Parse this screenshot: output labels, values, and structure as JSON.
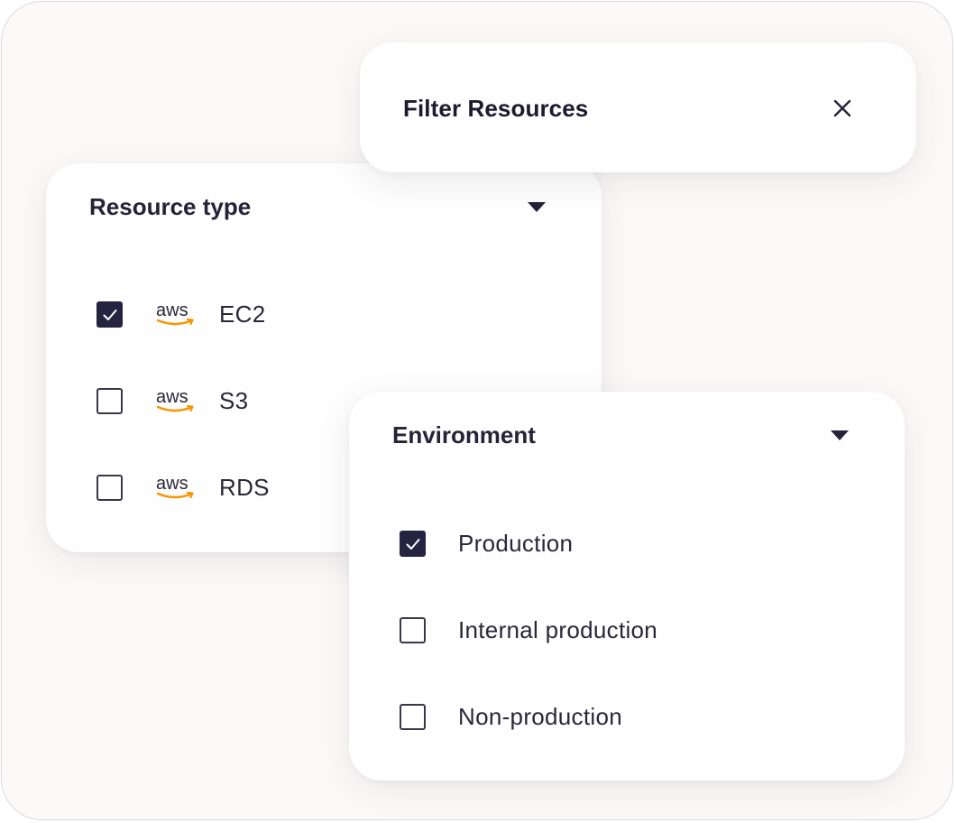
{
  "header": {
    "title": "Filter Resources",
    "close_icon": "close-icon"
  },
  "resource_type": {
    "title": "Resource type",
    "dropdown_icon": "caret-down-icon",
    "items": [
      {
        "label": "EC2",
        "checked": true,
        "logo_text": "aws",
        "logo": "aws-logo"
      },
      {
        "label": "S3",
        "checked": false,
        "logo_text": "aws",
        "logo": "aws-logo"
      },
      {
        "label": "RDS",
        "checked": false,
        "logo_text": "aws",
        "logo": "aws-logo"
      }
    ]
  },
  "environment": {
    "title": "Environment",
    "dropdown_icon": "caret-down-icon",
    "items": [
      {
        "label": "Production",
        "checked": true
      },
      {
        "label": "Internal production",
        "checked": false
      },
      {
        "label": "Non-production",
        "checked": false
      }
    ]
  },
  "colors": {
    "checkbox_checked": "#262341",
    "text": "#262338",
    "aws_smile": "#f79400",
    "background": "#fcfaf9"
  }
}
